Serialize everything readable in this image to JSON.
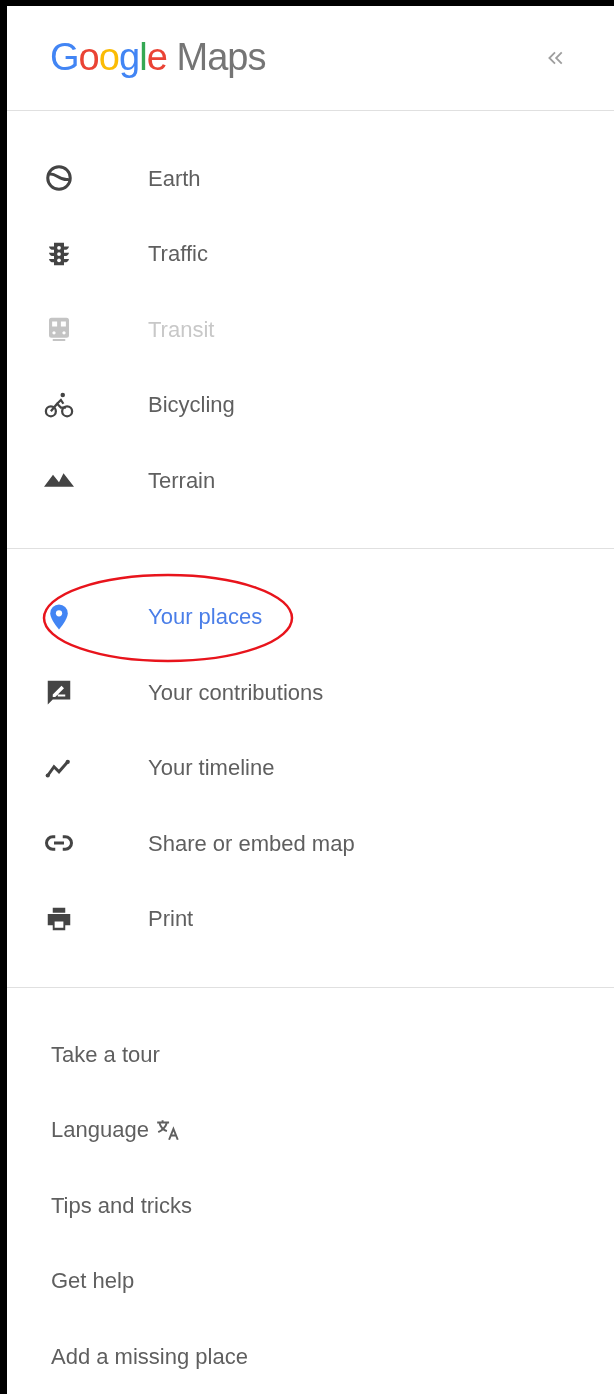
{
  "header": {
    "logo": {
      "brand": "Google",
      "product": "Maps"
    }
  },
  "layers": [
    {
      "label": "Earth",
      "disabled": false
    },
    {
      "label": "Traffic",
      "disabled": false
    },
    {
      "label": "Transit",
      "disabled": true
    },
    {
      "label": "Bicycling",
      "disabled": false
    },
    {
      "label": "Terrain",
      "disabled": false
    }
  ],
  "personal": [
    {
      "label": "Your places",
      "selected": true,
      "circled": true
    },
    {
      "label": "Your contributions",
      "selected": false,
      "circled": false
    },
    {
      "label": "Your timeline",
      "selected": false,
      "circled": false
    },
    {
      "label": "Share or embed map",
      "selected": false,
      "circled": false
    },
    {
      "label": "Print",
      "selected": false,
      "circled": false
    }
  ],
  "links": [
    {
      "label": "Take a tour",
      "kind": "plain"
    },
    {
      "label": "Language",
      "kind": "language"
    },
    {
      "label": "Tips and tricks",
      "kind": "plain"
    },
    {
      "label": "Get help",
      "kind": "plain"
    },
    {
      "label": "Add a missing place",
      "kind": "plain"
    }
  ]
}
